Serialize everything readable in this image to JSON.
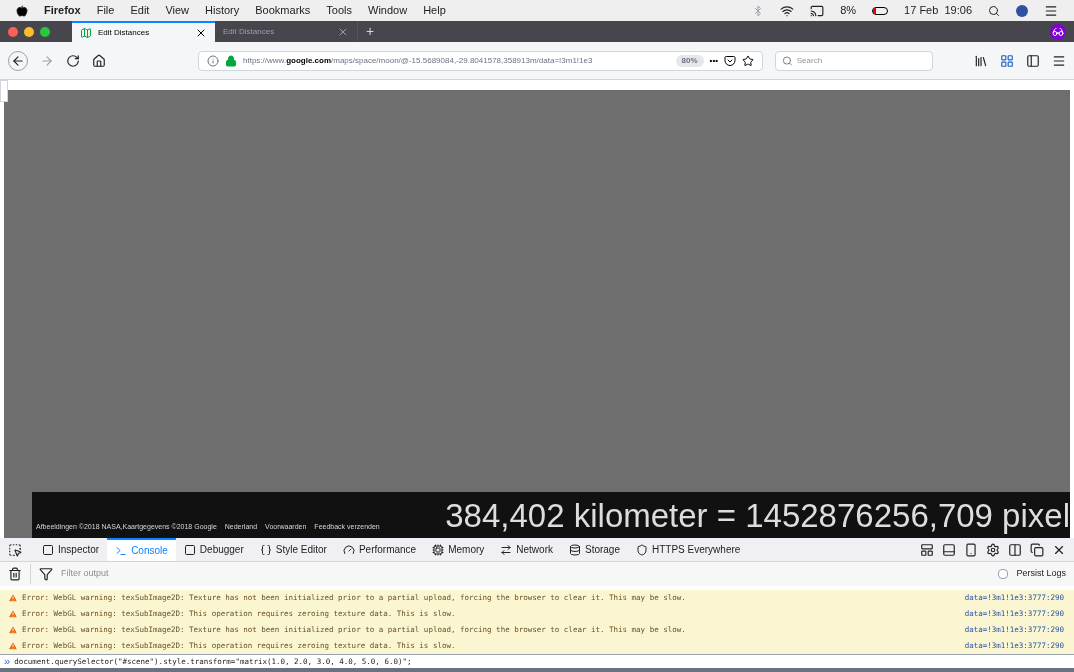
{
  "menu_bar": {
    "app": "Firefox",
    "items": [
      "File",
      "Edit",
      "View",
      "History",
      "Bookmarks",
      "Tools",
      "Window",
      "Help"
    ],
    "battery": "8%",
    "clock": "17 Feb  19:06"
  },
  "tabs": [
    {
      "title": "Edit Distances",
      "selected": true
    },
    {
      "title": "Edit Distances",
      "selected": false
    }
  ],
  "new_tab": "+",
  "address_bar": {
    "url_prefix": "https://www.",
    "url_domain": "google.com",
    "url_rest": "/maps/space/moon/@-15.5689084,-29.8041578,358913m/data=!3m1!1e3",
    "zoom": "80%",
    "more": "•••"
  },
  "search": {
    "placeholder": "Search"
  },
  "map": {
    "attribution": [
      "Afbeeldingen ©2018 NASA,Kaartgegevens ©2018 Google",
      "Nederland",
      "Voorwaarden",
      "Feedback verzenden"
    ],
    "overlay_text": "384,402 kilometer = 1452876256,709 pixel"
  },
  "devtools": {
    "tabs": [
      {
        "label": "Inspector",
        "selected": false
      },
      {
        "label": "Console",
        "selected": true
      },
      {
        "label": "Debugger",
        "selected": false
      },
      {
        "label": "Style Editor",
        "selected": false
      },
      {
        "label": "Performance",
        "selected": false
      },
      {
        "label": "Memory",
        "selected": false
      },
      {
        "label": "Network",
        "selected": false
      },
      {
        "label": "Storage",
        "selected": false
      },
      {
        "label": "HTTPS Everywhere",
        "selected": false
      }
    ],
    "filter_placeholder": "Filter output",
    "persist_logs": {
      "label": "Persist Logs",
      "checked": false
    },
    "messages": [
      {
        "kind": "warning",
        "text": "Error: WebGL warning: texSubImage2D: Texture has not been initialized prior to a partial upload, forcing the browser to clear it. This may be slow.",
        "source": "data=!3m1!1e3:3777:290"
      },
      {
        "kind": "warning",
        "text": "Error: WebGL warning: texSubImage2D: This operation requires zeroing texture data. This is slow.",
        "source": "data=!3m1!1e3:3777:290"
      },
      {
        "kind": "warning",
        "text": "Error: WebGL warning: texSubImage2D: Texture has not been initialized prior to a partial upload, forcing the browser to clear it. This may be slow.",
        "source": "data=!3m1!1e3:3777:290"
      },
      {
        "kind": "warning",
        "text": "Error: WebGL warning: texSubImage2D: This operation requires zeroing texture data. This is slow.",
        "source": "data=!3m1!1e3:3777:290"
      }
    ],
    "prompt": "»",
    "input": "document.querySelector(\"#scene\").style.transform=\"matrix(1.0, 2.0, 3.0, 4.0, 5.0, 6.0)\";"
  }
}
